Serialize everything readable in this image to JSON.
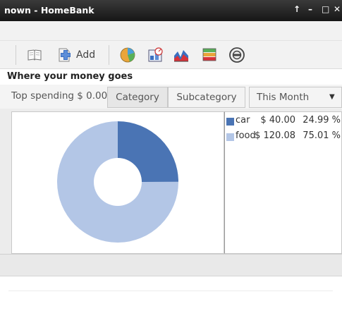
{
  "window": {
    "title": "nown - HomeBank",
    "controls": [
      "↑",
      "–",
      "□",
      "✕"
    ]
  },
  "toolbar": {
    "add_label": "Add",
    "icons": [
      "book-icon",
      "add-transaction-icon",
      "pie-chart-icon",
      "budget-icon",
      "trend-chart-icon",
      "balance-icon",
      "vehicle-cost-icon"
    ]
  },
  "section": {
    "title": "Where your money goes"
  },
  "filter": {
    "top_spending": "Top spending $ 0.00",
    "category_label": "Category",
    "subcategory_label": "Subcategory",
    "period_value": "This Month"
  },
  "chart_data": {
    "type": "pie",
    "style": "donut",
    "categories": [
      "car",
      "food"
    ],
    "values": [
      40.0,
      120.08
    ],
    "amounts": [
      "$ 40.00",
      "$ 120.08"
    ],
    "percentages": [
      "24.99 %",
      "75.01 %"
    ],
    "colors": [
      "#4a74b4",
      "#b3c6e6"
    ],
    "legend": "right"
  }
}
